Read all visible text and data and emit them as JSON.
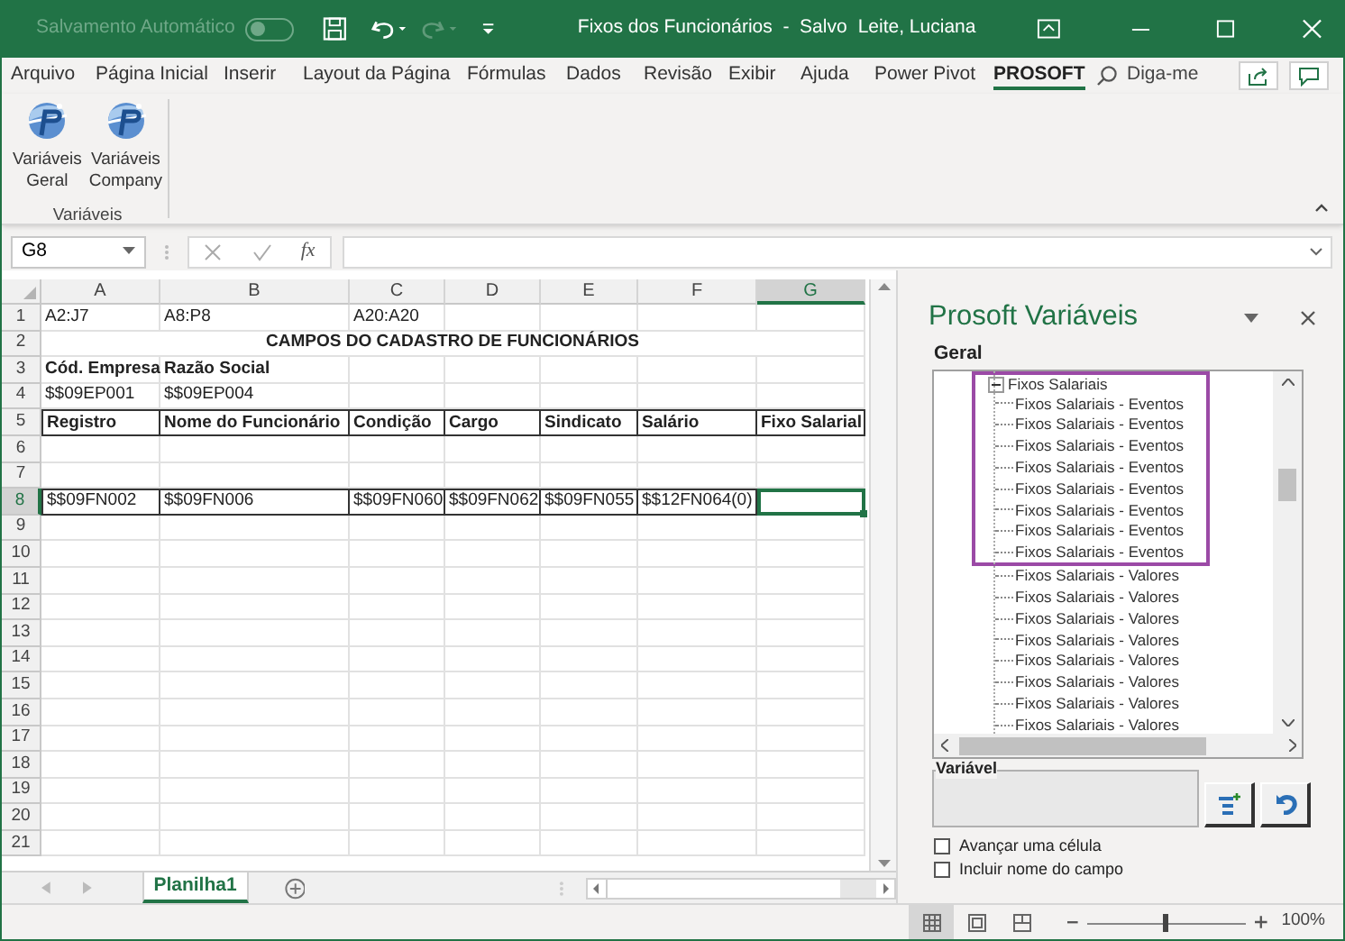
{
  "title_bar": {
    "autosave_label": "Salvamento Automático",
    "autosave_on": false,
    "title": "Fixos dos Funcionários  -  Salvo",
    "user": "Leite, Luciana"
  },
  "menu_tabs": [
    {
      "label": "Arquivo",
      "selected": false
    },
    {
      "label": "Página Inicial",
      "selected": false
    },
    {
      "label": "Inserir",
      "selected": false
    },
    {
      "label": "Layout da Página",
      "selected": false
    },
    {
      "label": "Fórmulas",
      "selected": false
    },
    {
      "label": "Dados",
      "selected": false
    },
    {
      "label": "Revisão",
      "selected": false
    },
    {
      "label": "Exibir",
      "selected": false
    },
    {
      "label": "Ajuda",
      "selected": false
    },
    {
      "label": "Power Pivot",
      "selected": false
    },
    {
      "label": "PROSOFT",
      "selected": true
    }
  ],
  "tell_me": {
    "placeholder": "Diga-me"
  },
  "ribbon": {
    "group_label": "Variáveis",
    "buttons": [
      {
        "line1": "Variáveis",
        "line2": "Geral"
      },
      {
        "line1": "Variáveis",
        "line2": "Company"
      }
    ]
  },
  "formula_bar": {
    "name_box": "G8",
    "fx": "fx"
  },
  "sheet": {
    "columns": [
      {
        "label": "A",
        "selected": false
      },
      {
        "label": "B",
        "selected": false
      },
      {
        "label": "C",
        "selected": false
      },
      {
        "label": "D",
        "selected": false
      },
      {
        "label": "E",
        "selected": false
      },
      {
        "label": "F",
        "selected": false
      },
      {
        "label": "G",
        "selected": true
      }
    ],
    "rows": [
      {
        "number": "1",
        "selected": false,
        "kind": "cells",
        "cells": [
          "A2:J7",
          "A8:P8",
          "A20:A20"
        ]
      },
      {
        "number": "2",
        "selected": false,
        "kind": "title",
        "text": "CAMPOS DO CADASTRO DE FUNCIONÁRIOS"
      },
      {
        "number": "3",
        "selected": false,
        "kind": "cells",
        "bold": true,
        "cells": [
          "Cód. Empresa",
          "Razão Social"
        ]
      },
      {
        "number": "4",
        "selected": false,
        "kind": "cells",
        "cells": [
          "$$09EP001",
          "$$09EP004"
        ]
      },
      {
        "number": "5",
        "selected": false,
        "kind": "cells",
        "bold": true,
        "bordered": true,
        "cells": [
          "Registro",
          "Nome do Funcionário",
          "Condição",
          "Cargo",
          "Sindicato",
          "Salário",
          "Fixo Salarial"
        ]
      },
      {
        "number": "6",
        "selected": false,
        "kind": "empty"
      },
      {
        "number": "7",
        "selected": false,
        "kind": "empty"
      },
      {
        "number": "8",
        "selected": true,
        "kind": "cells",
        "bordered": true,
        "cells": [
          "$$09FN002",
          "$$09FN006",
          "$$09FN060",
          "$$09FN062",
          "$$09FN055",
          "$$12FN064(0)"
        ]
      },
      {
        "number": "9",
        "selected": false,
        "kind": "empty"
      },
      {
        "number": "10",
        "selected": false,
        "kind": "empty"
      },
      {
        "number": "11",
        "selected": false,
        "kind": "empty"
      },
      {
        "number": "12",
        "selected": false,
        "kind": "empty"
      },
      {
        "number": "13",
        "selected": false,
        "kind": "empty"
      },
      {
        "number": "14",
        "selected": false,
        "kind": "empty"
      },
      {
        "number": "15",
        "selected": false,
        "kind": "empty"
      },
      {
        "number": "16",
        "selected": false,
        "kind": "empty"
      },
      {
        "number": "17",
        "selected": false,
        "kind": "empty"
      },
      {
        "number": "18",
        "selected": false,
        "kind": "empty"
      },
      {
        "number": "19",
        "selected": false,
        "kind": "empty"
      },
      {
        "number": "20",
        "selected": false,
        "kind": "empty"
      },
      {
        "number": "21",
        "selected": false,
        "kind": "empty"
      }
    ],
    "sheet_tabs": [
      {
        "label": "Planilha1",
        "selected": true
      }
    ]
  },
  "task_pane": {
    "title": "Prosoft Variáveis",
    "section": "Geral",
    "tree": [
      {
        "label": "Fixos Salariais",
        "expanded": true,
        "highlighted": true,
        "children": [
          {
            "label": "Fixos Salariais - Eventos",
            "highlighted": true
          },
          {
            "label": "Fixos Salariais - Eventos",
            "highlighted": true
          },
          {
            "label": "Fixos Salariais - Eventos",
            "highlighted": true
          },
          {
            "label": "Fixos Salariais - Eventos",
            "highlighted": true
          },
          {
            "label": "Fixos Salariais - Eventos",
            "highlighted": true
          },
          {
            "label": "Fixos Salariais - Eventos",
            "highlighted": true
          },
          {
            "label": "Fixos Salariais - Eventos",
            "highlighted": true
          },
          {
            "label": "Fixos Salariais - Eventos",
            "highlighted": true
          },
          {
            "label": "Fixos Salariais - Valores",
            "highlighted": false
          },
          {
            "label": "Fixos Salariais - Valores",
            "highlighted": false
          },
          {
            "label": "Fixos Salariais - Valores",
            "highlighted": false
          },
          {
            "label": "Fixos Salariais - Valores",
            "highlighted": false
          },
          {
            "label": "Fixos Salariais - Valores",
            "highlighted": false
          },
          {
            "label": "Fixos Salariais - Valores",
            "highlighted": false
          },
          {
            "label": "Fixos Salariais - Valores",
            "highlighted": false
          },
          {
            "label": "Fixos Salariais - Valores",
            "highlighted": false
          }
        ]
      }
    ],
    "variable_label": "Variável",
    "options": [
      {
        "label": "Avançar uma célula",
        "checked": false
      },
      {
        "label": "Incluir nome do campo",
        "checked": false
      }
    ]
  },
  "status_bar": {
    "views": [
      {
        "kind": "normal",
        "selected": true
      },
      {
        "kind": "page_layout",
        "selected": false
      },
      {
        "kind": "page_break",
        "selected": false
      }
    ],
    "zoom": {
      "level": 0.5,
      "label": "100%"
    }
  }
}
